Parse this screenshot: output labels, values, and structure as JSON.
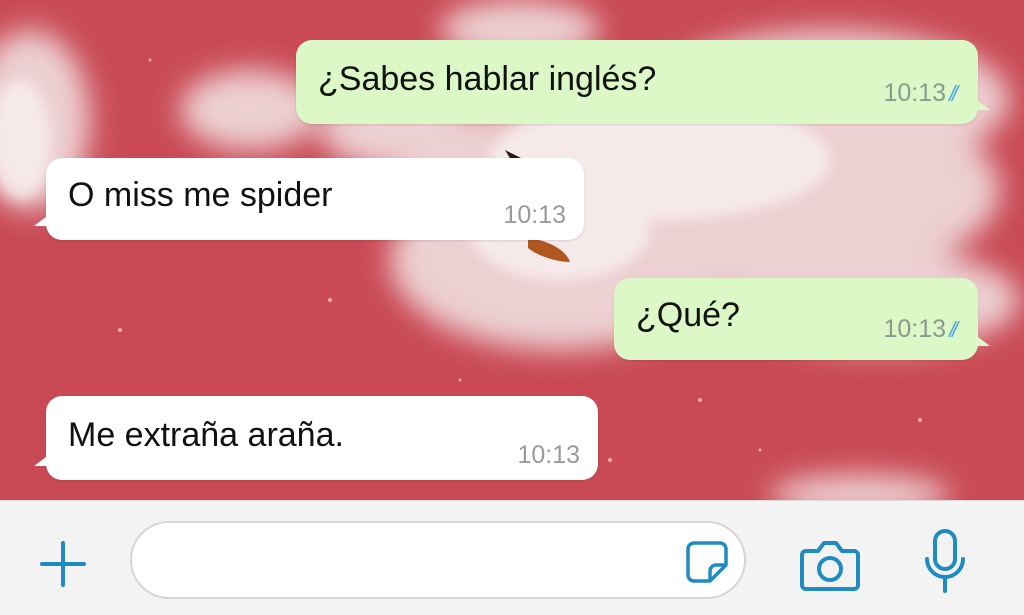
{
  "theme": {
    "accent": "#1e8bc3",
    "outgoing_bubble": "#dcf8c6",
    "incoming_bubble": "#ffffff",
    "read_ticks": "#4fa8e8",
    "chat_background": "#c94a55"
  },
  "messages": [
    {
      "direction": "outgoing",
      "text": "¿Sabes hablar inglés?",
      "time": "10:13",
      "status": "read"
    },
    {
      "direction": "incoming",
      "text": "O miss me spider",
      "time": "10:13"
    },
    {
      "direction": "outgoing",
      "text": "¿Qué?",
      "time": "10:13",
      "status": "read"
    },
    {
      "direction": "incoming",
      "text": "Me extraña araña.",
      "time": "10:13"
    }
  ],
  "composer": {
    "placeholder": "",
    "icons": [
      "plus-icon",
      "sticker-icon",
      "camera-icon",
      "microphone-icon"
    ]
  }
}
